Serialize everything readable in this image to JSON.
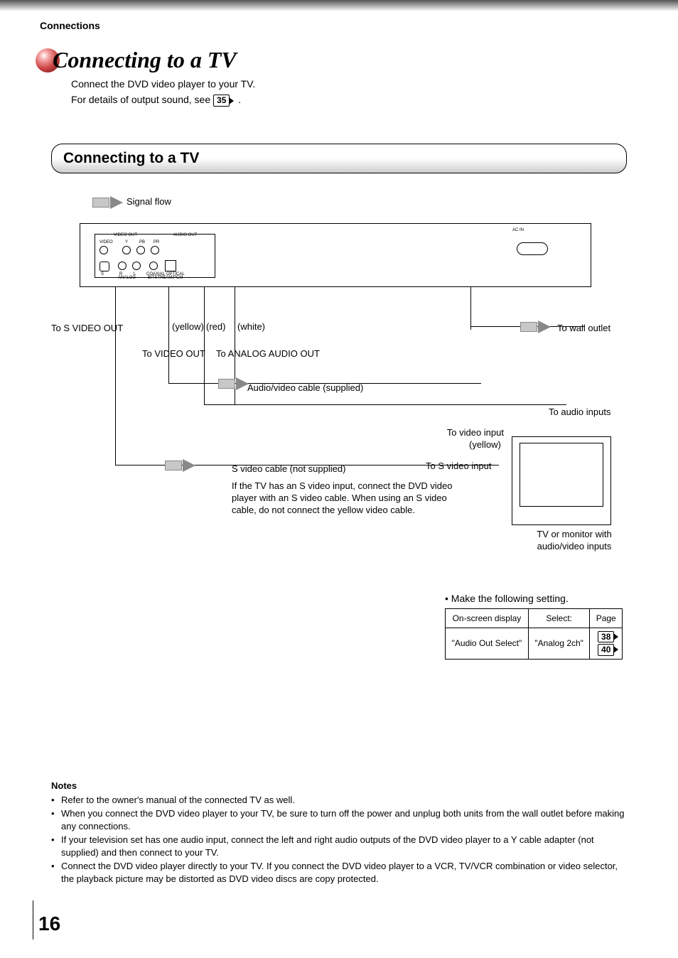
{
  "header": {
    "section": "Connections"
  },
  "title": {
    "main": "Connecting to a TV",
    "sub1": "Connect the DVD video player to your TV.",
    "sub2_a": "For details of output sound, see ",
    "sub2_ref": "35",
    "sub2_b": "."
  },
  "section_heading": "Connecting to a TV",
  "diagram": {
    "signal_flow": "Signal flow",
    "to_s_video_out": "To S VIDEO OUT",
    "yellow": "(yellow)",
    "red": "(red)",
    "white": "(white)",
    "to_video_out": "To VIDEO OUT",
    "to_analog_audio_out": "To ANALOG AUDIO OUT",
    "av_cable": "Audio/video cable (supplied)",
    "s_video_cable": "S video cable (not supplied)",
    "hint": "If the TV has an S video input, connect the DVD video player with an S video cable. When using an S video cable, do not connect the yellow video cable.",
    "to_wall": "To wall outlet",
    "to_audio_inputs": "To audio inputs",
    "to_video_input": "To video input",
    "to_s_video_input": "To S video input",
    "tv_caption": "TV or monitor with audio/video inputs",
    "ac_in": "AC IN",
    "ports": {
      "video_out": "VIDEO OUT",
      "audio_out": "AUDIO OUT",
      "video": "VIDEO",
      "y": "Y",
      "pb": "PB",
      "pr": "PR",
      "s": "S",
      "r": "R",
      "l": "L",
      "analog": "ANALOG",
      "coax": "COAXIAL",
      "opt": "OPTICAL",
      "bit": "BITSTREAM/PCM"
    }
  },
  "setting": {
    "bullet": "Make the following setting.",
    "h1": "On-screen display",
    "h2": "Select:",
    "h3": "Page",
    "r1c1": "\"Audio Out Select\"",
    "r1c2": "\"Analog 2ch\"",
    "r1c3a": "38",
    "r1c3b": "40"
  },
  "notes": {
    "title": "Notes",
    "items": [
      "Refer to the owner's manual of the connected TV as well.",
      "When you connect the DVD video player to your TV, be sure to turn off the power and unplug both units from the wall outlet before making any connections.",
      "If your television set has one audio input, connect the left and right audio outputs of the DVD video player to a Y cable adapter (not supplied) and then connect to your TV.",
      "Connect the DVD video player directly to your TV.  If you connect the DVD video player to a VCR, TV/VCR combination or video selector, the playback picture may be distorted as DVD video discs are copy protected."
    ]
  },
  "page_number": "16"
}
